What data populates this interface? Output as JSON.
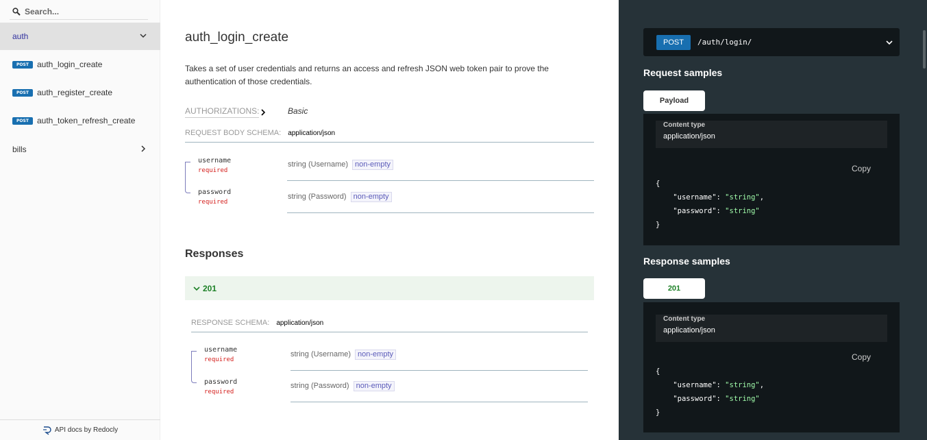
{
  "sidebar": {
    "search_placeholder": "Search...",
    "groups": [
      {
        "label": "auth"
      },
      {
        "label": "bills"
      }
    ],
    "items": [
      {
        "badge": "POST",
        "label": "auth_login_create"
      },
      {
        "badge": "POST",
        "label": "auth_register_create"
      },
      {
        "badge": "POST",
        "label": "auth_token_refresh_create"
      }
    ],
    "footer": "API docs by Redocly"
  },
  "operation": {
    "title": "auth_login_create",
    "description": "Takes a set of user credentials and returns an access and refresh JSON web token pair to prove the authentication of those credentials.",
    "authorizations_label": "AUTHORIZATIONS:",
    "authorizations_value": "Basic",
    "request_schema_label": "REQUEST BODY SCHEMA:",
    "request_content_type": "application/json",
    "request_fields": [
      {
        "name": "username",
        "required": "required",
        "type": "string (Username)",
        "constraint": "non-empty"
      },
      {
        "name": "password",
        "required": "required",
        "type": "string (Password)",
        "constraint": "non-empty"
      }
    ],
    "responses_title": "Responses",
    "response_code": "201",
    "response_schema_label": "RESPONSE SCHEMA:",
    "response_content_type": "application/json",
    "response_fields": [
      {
        "name": "username",
        "required": "required",
        "type": "string (Username)",
        "constraint": "non-empty"
      },
      {
        "name": "password",
        "required": "required",
        "type": "string (Password)",
        "constraint": "non-empty"
      }
    ]
  },
  "right_panel": {
    "method": "POST",
    "path": "/auth/login/",
    "request_samples_title": "Request samples",
    "request_tab": "Payload",
    "response_samples_title": "Response samples",
    "response_tab": "201",
    "content_type_label": "Content type",
    "content_type_value": "application/json",
    "copy_label": "Copy",
    "code": {
      "open": "{",
      "close": "}",
      "k1": "\"username\"",
      "v1": "\"string\"",
      "k2": "\"password\"",
      "v2": "\"string\""
    }
  },
  "colors": {
    "post_badge": "#186fb0",
    "active_nav_text": "#32329f",
    "required": "#d41f1c",
    "success": "#1d8127",
    "right_panel_bg": "#263238",
    "code_bg": "#11171a",
    "json_string": "#a0fbaa"
  }
}
